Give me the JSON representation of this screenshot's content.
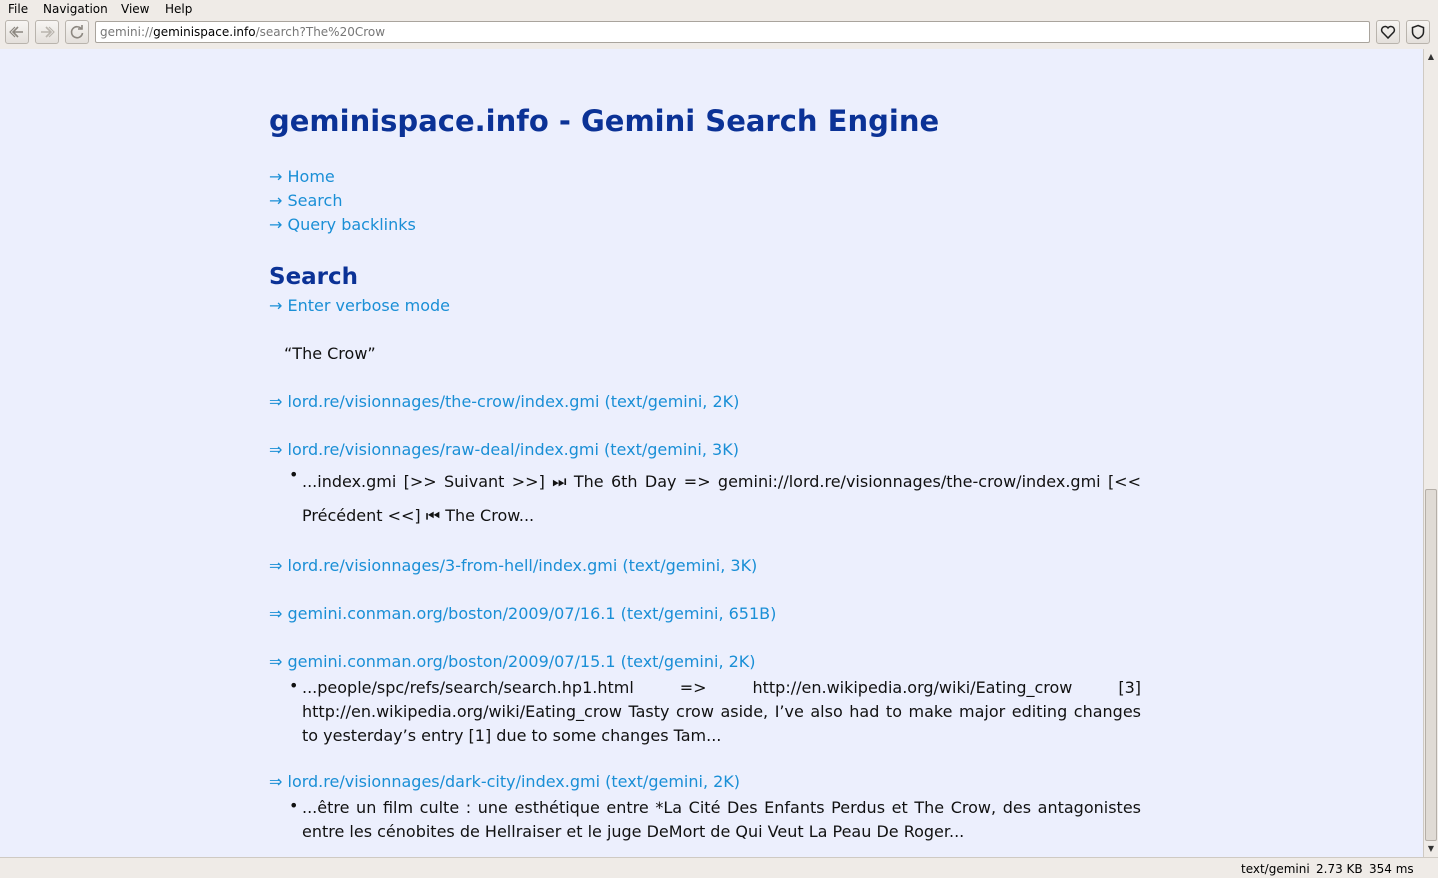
{
  "menu": {
    "file": "File",
    "navigation": "Navigation",
    "view": "View",
    "help": "Help"
  },
  "toolbar": {
    "url_scheme": "gemini://",
    "url_host": "geminispace.info",
    "url_path": "/search?The%20Crow"
  },
  "page": {
    "title": "geminispace.info - Gemini Search Engine",
    "nav_links": [
      "→ Home",
      "→ Search",
      "→ Query backlinks"
    ],
    "section_heading": "Search",
    "verbose_link": "→ Enter verbose mode",
    "query": "“The Crow”",
    "results": [
      {
        "link": "⇒ lord.re/visionnages/the-crow/index.gmi (text/gemini, 2K)"
      },
      {
        "link": "⇒ lord.re/visionnages/raw-deal/index.gmi (text/gemini, 3K)",
        "snippet": "...index.gmi [>> Suivant >>] ⏭ The 6th Day => gemini://lord.re/visionnages/the-crow/index.gmi [<< Précédent <<] ⏮ The Crow..."
      },
      {
        "link": "⇒ lord.re/visionnages/3-from-hell/index.gmi (text/gemini, 3K)"
      },
      {
        "link": "⇒ gemini.conman.org/boston/2009/07/16.1 (text/gemini, 651B)"
      },
      {
        "link": "⇒ gemini.conman.org/boston/2009/07/15.1 (text/gemini, 2K)",
        "snippet": "...people/spc/refs/search/search.hp1.html => http://en.wikipedia.org/wiki/Eating_crow [3] http://en.wikipedia.org/wiki/Eating_crow Tasty crow aside, I’ve also had to make major editing changes to yesterday’s entry [1] due to some changes Tam..."
      },
      {
        "link": "⇒ lord.re/visionnages/dark-city/index.gmi (text/gemini, 2K)",
        "snippet": "...être un film culte : une esthétique entre *La Cité Des Enfants Perdus et The Crow, des antagonistes entre les cénobites de Hellraiser et le juge DeMort de Qui Veut La Peau De Roger..."
      }
    ]
  },
  "status": {
    "mime": "text/gemini",
    "size": "2.73 KB",
    "time": "354 ms"
  },
  "colors": {
    "link": "#1a8fd6",
    "heading": "#0b3296",
    "background": "#eceffd"
  }
}
